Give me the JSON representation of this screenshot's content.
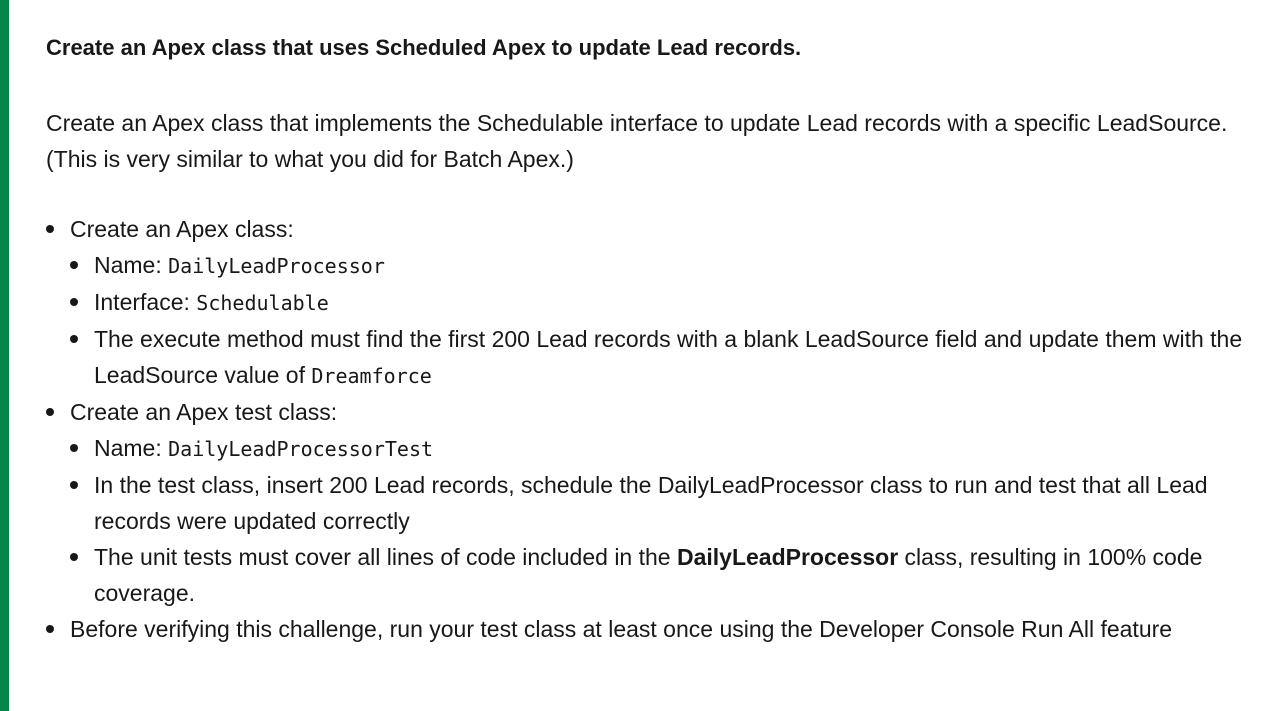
{
  "heading": "Create an Apex class that uses Scheduled Apex to update Lead records.",
  "intro": "Create an Apex class that implements the Schedulable interface to update Lead records with a specific LeadSource. (This is very similar to what you did for Batch Apex.)",
  "requirements": [
    {
      "text": "Create an Apex class:",
      "items": [
        {
          "label": "Name: ",
          "code": "DailyLeadProcessor"
        },
        {
          "label": "Interface: ",
          "code": "Schedulable"
        },
        {
          "label": "The execute method must find the first 200 Lead records with a blank LeadSource field and update them with the LeadSource value of ",
          "code": "Dreamforce"
        }
      ]
    },
    {
      "text": "Create an Apex test class:",
      "items": [
        {
          "label": "Name: ",
          "code": "DailyLeadProcessorTest"
        },
        {
          "label": "In the test class, insert 200 Lead records, schedule the DailyLeadProcessor class to run and test that all Lead records were updated correctly"
        },
        {
          "before": "The unit tests must cover all lines of code included in the ",
          "bold": "DailyLeadProcessor",
          "after": " class, resulting in 100% code coverage."
        }
      ]
    },
    {
      "text": "Before verifying this challenge, run your test class at least once using the Developer Console Run All feature"
    }
  ],
  "accent_color": "#04844b"
}
